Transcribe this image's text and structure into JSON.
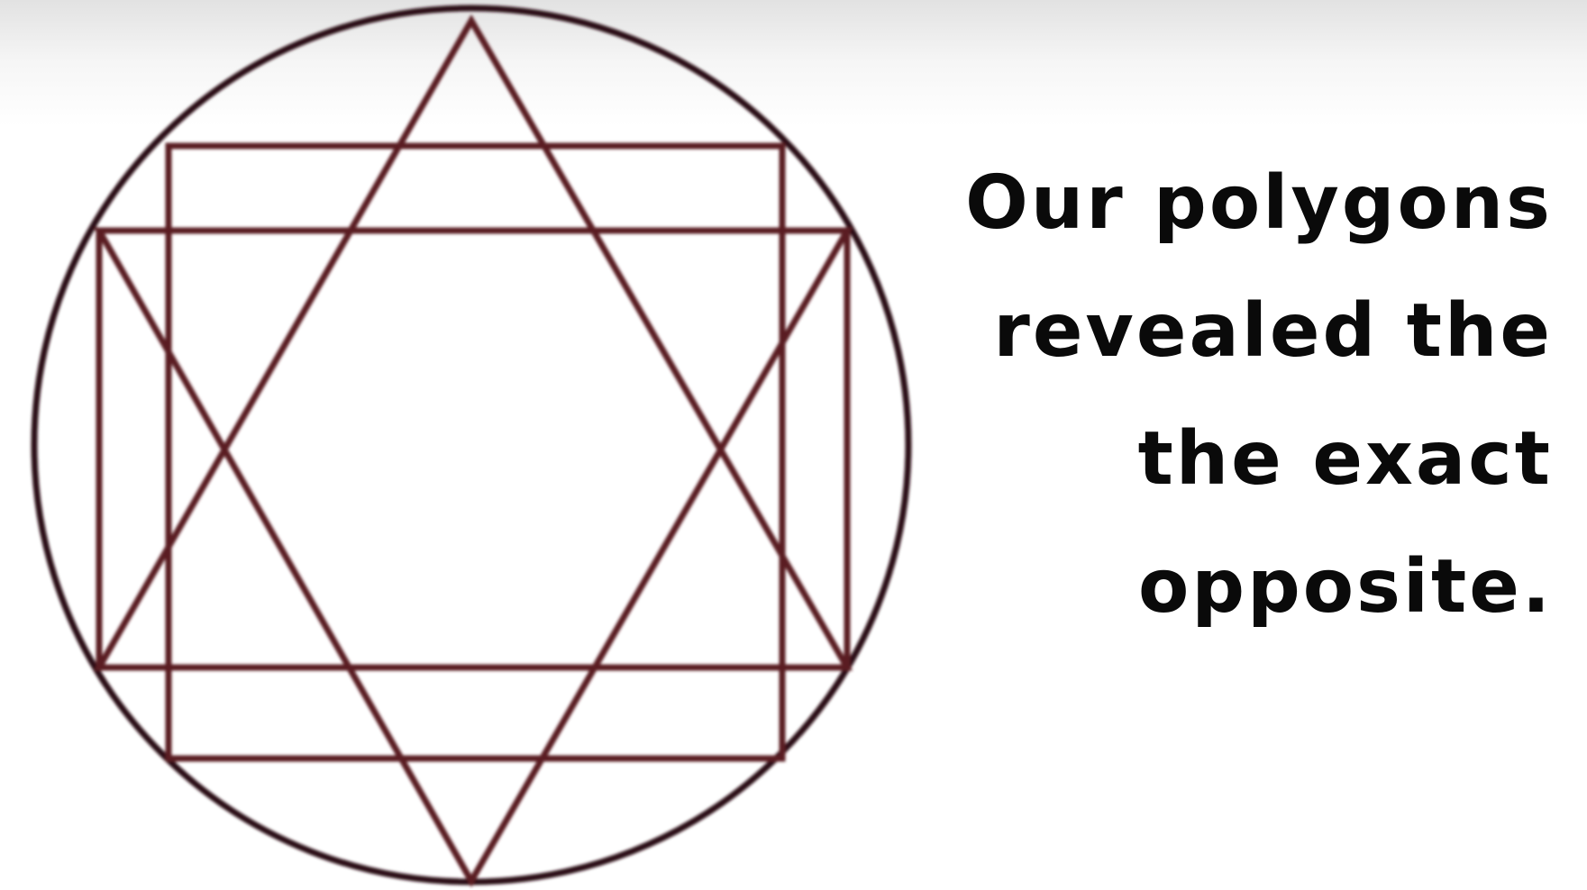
{
  "caption": {
    "lines": [
      "Our polygons",
      "revealed the",
      "the exact",
      "opposite."
    ]
  },
  "figure": {
    "shapes": [
      "circle",
      "square",
      "square",
      "triangle-up",
      "triangle-down"
    ],
    "colors": {
      "circle": "#2a0e12",
      "lines": "#5a1e24"
    }
  }
}
